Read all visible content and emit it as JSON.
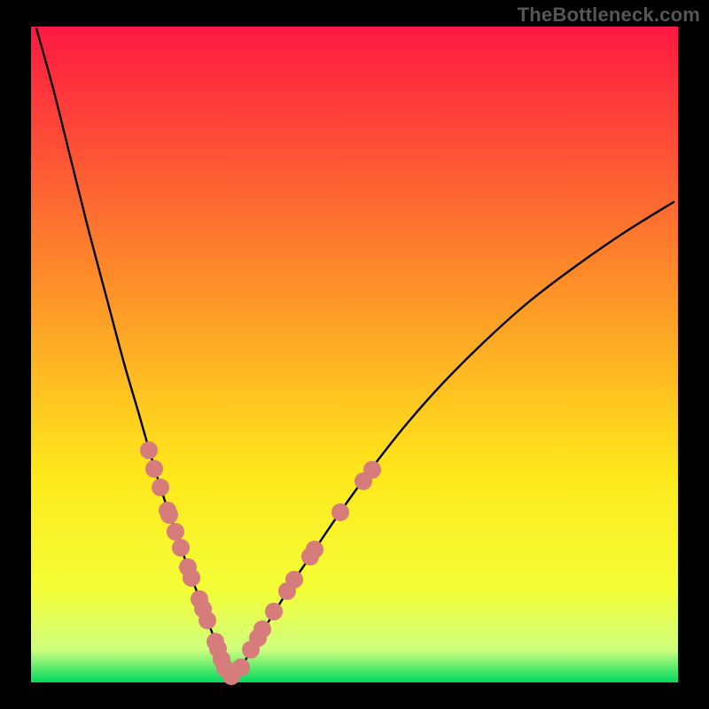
{
  "watermark": "TheBottleneck.com",
  "chart_data": {
    "type": "line",
    "title": "",
    "xlabel": "",
    "ylabel": "",
    "xlim": [
      35,
      765
    ],
    "ylim": [
      30,
      770
    ],
    "background_gradient": {
      "top": "#fe1842",
      "mid1": "#fd8b29",
      "mid2": "#fee81b",
      "mid3": "#f3fe37",
      "mid4": "#d0fe7e",
      "bottom": "#00da5f"
    },
    "series": [
      {
        "name": "curve",
        "x": [
          41,
          60,
          80,
          100,
          120,
          140,
          157,
          169,
          178,
          186,
          194,
          200,
          206,
          212,
          218,
          224,
          229,
          234,
          239,
          244,
          249,
          254,
          259,
          265,
          272,
          278,
          285,
          293,
          302,
          312,
          323,
          335,
          350,
          370,
          395,
          425,
          460,
          500,
          545,
          595,
          650,
          705,
          760
        ],
        "y": [
          32,
          100,
          180,
          260,
          335,
          410,
          468,
          510,
          540,
          565,
          588,
          606,
          623,
          640,
          657,
          672,
          686,
          700,
          713,
          726,
          741,
          753,
          763,
          763,
          753,
          743,
          731,
          718,
          703,
          687,
          669,
          650,
          628,
          598,
          562,
          521,
          477,
          432,
          387,
          342,
          300,
          262,
          228
        ]
      }
    ],
    "markers": {
      "color": "#d67c7a",
      "radius": 10,
      "points": [
        {
          "x": 168,
          "y": 508
        },
        {
          "x": 174,
          "y": 529
        },
        {
          "x": 181,
          "y": 550
        },
        {
          "x": 189,
          "y": 576
        },
        {
          "x": 191,
          "y": 581
        },
        {
          "x": 198,
          "y": 600
        },
        {
          "x": 204,
          "y": 618
        },
        {
          "x": 212,
          "y": 640
        },
        {
          "x": 216,
          "y": 652
        },
        {
          "x": 225,
          "y": 676
        },
        {
          "x": 229,
          "y": 687
        },
        {
          "x": 234,
          "y": 700
        },
        {
          "x": 243,
          "y": 724
        },
        {
          "x": 246,
          "y": 732
        },
        {
          "x": 250,
          "y": 744
        },
        {
          "x": 254,
          "y": 754
        },
        {
          "x": 261,
          "y": 763
        },
        {
          "x": 272,
          "y": 753
        },
        {
          "x": 283,
          "y": 733
        },
        {
          "x": 291,
          "y": 720
        },
        {
          "x": 296,
          "y": 710
        },
        {
          "x": 309,
          "y": 690
        },
        {
          "x": 324,
          "y": 667
        },
        {
          "x": 332,
          "y": 654
        },
        {
          "x": 350,
          "y": 628
        },
        {
          "x": 355,
          "y": 620
        },
        {
          "x": 384,
          "y": 578
        },
        {
          "x": 410,
          "y": 543
        },
        {
          "x": 420,
          "y": 530
        }
      ]
    }
  }
}
